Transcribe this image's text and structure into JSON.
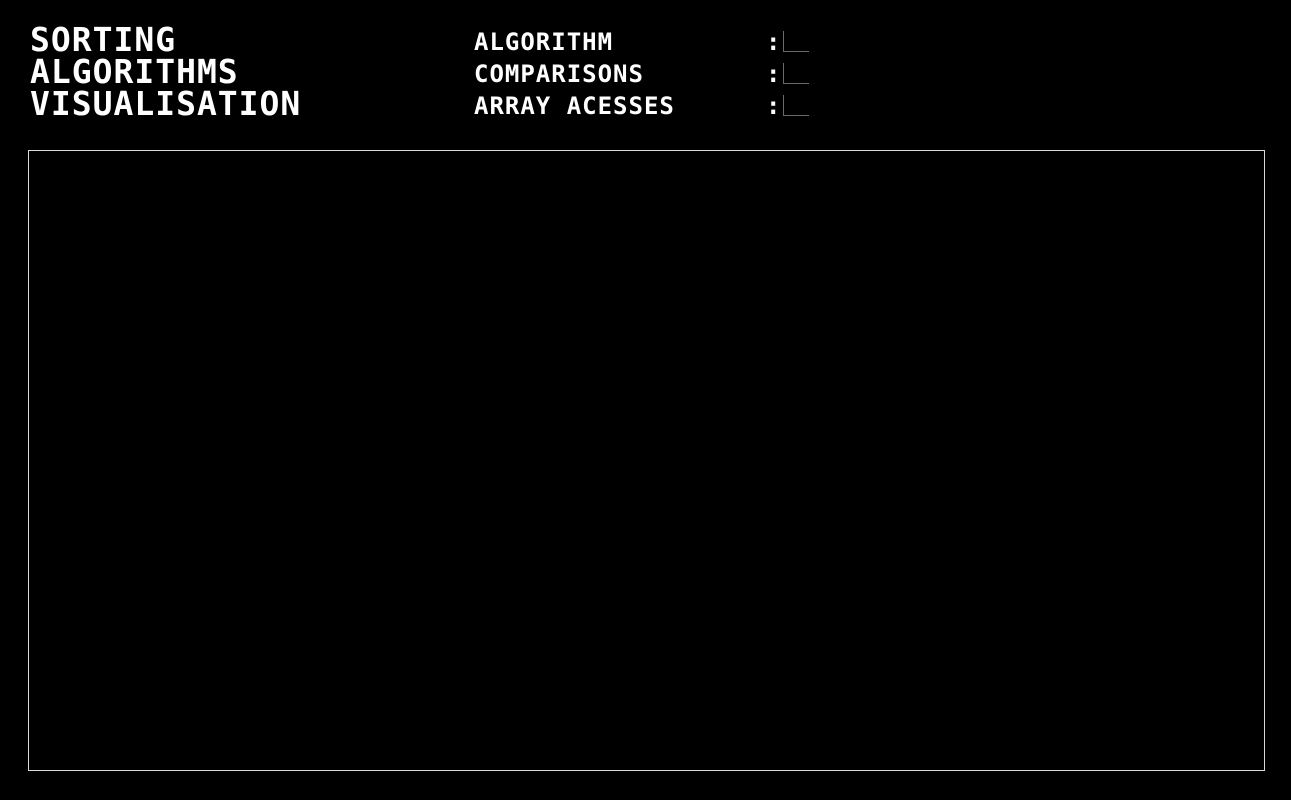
{
  "app": {
    "title_lines": [
      "SORTING",
      "ALGORITHMS",
      "VISUALISATION"
    ]
  },
  "stats": [
    {
      "label": "ALGORITHM",
      "separator": ":",
      "value": ""
    },
    {
      "label": "COMPARISONS",
      "separator": ":",
      "value": ""
    },
    {
      "label": "ARRAY ACESSES",
      "separator": ":",
      "value": ""
    }
  ],
  "colors": {
    "background": "#000000",
    "text": "#ffffff",
    "value_accent": "#ff2a2a",
    "canvas_border": "#d9d9d9"
  }
}
